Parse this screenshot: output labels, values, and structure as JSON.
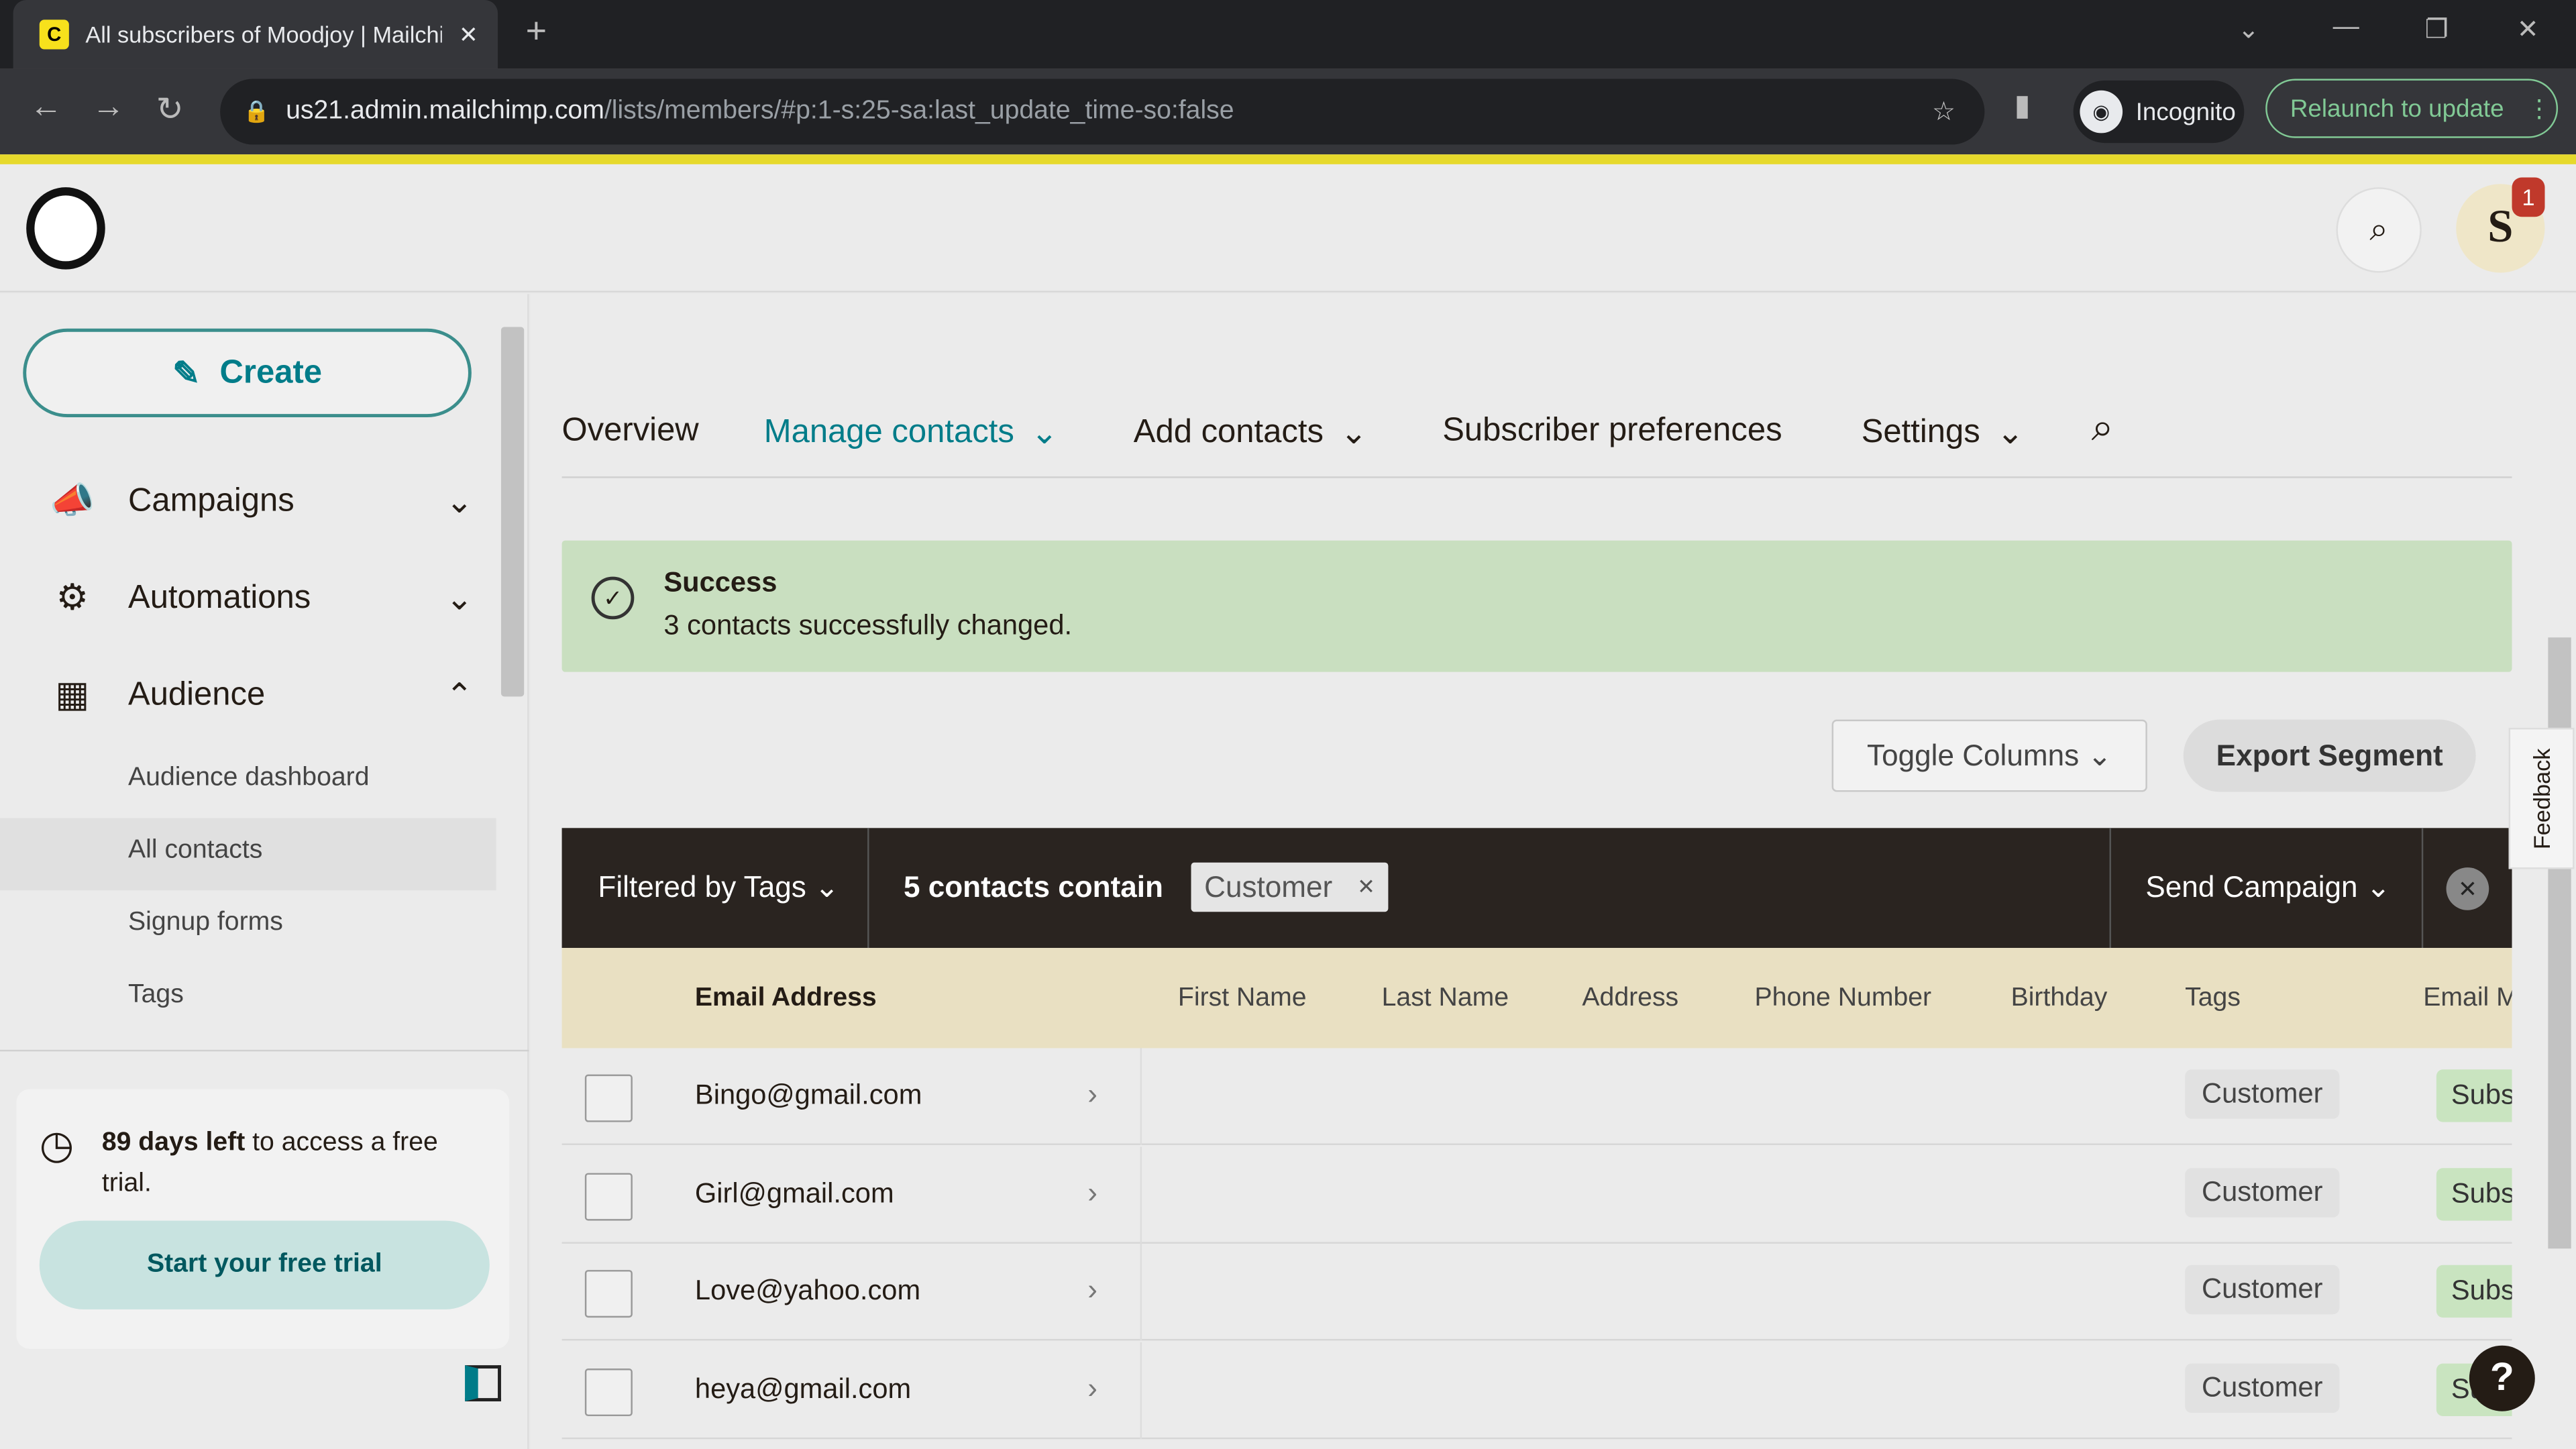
{
  "browser": {
    "tab_title": "All subscribers of Moodjoy | Mailchimp",
    "url_host": "us21.admin.mailchimp.com",
    "url_path": "/lists/members/#p:1-s:25-sa:last_update_time-so:false",
    "incognito": "Incognito",
    "relaunch": "Relaunch to update"
  },
  "header": {
    "avatar_letter": "S",
    "notification_count": "1"
  },
  "sidebar": {
    "create": "Create",
    "items": [
      {
        "label": "Campaigns",
        "icon": "megaphone-icon"
      },
      {
        "label": "Automations",
        "icon": "automation-icon"
      },
      {
        "label": "Audience",
        "icon": "audience-icon"
      }
    ],
    "audience_sub": [
      "Audience dashboard",
      "All contacts",
      "Signup forms",
      "Tags"
    ],
    "trial_days": "89 days left",
    "trial_rest": " to access a free trial.",
    "trial_button": "Start your free trial"
  },
  "tabs": [
    "Overview",
    "Manage contacts",
    "Add contacts",
    "Subscriber preferences",
    "Settings"
  ],
  "success": {
    "title": "Success",
    "message": "3 contacts successfully changed."
  },
  "toolbar": {
    "toggle_columns": "Toggle Columns",
    "export_segment": "Export Segment"
  },
  "filter": {
    "filtered_by": "Filtered by Tags",
    "count_text": "5 contacts contain",
    "tag": "Customer",
    "send_campaign": "Send Campaign"
  },
  "table": {
    "columns": [
      "Email Address",
      "First Name",
      "Last Name",
      "Address",
      "Phone Number",
      "Birthday",
      "Tags",
      "Email Marketing"
    ],
    "rows": [
      {
        "email": "Bingo@gmail.com",
        "tag": "Customer",
        "status": "Subscribed"
      },
      {
        "email": "Girl@gmail.com",
        "tag": "Customer",
        "status": "Subscribed"
      },
      {
        "email": "Love@yahoo.com",
        "tag": "Customer",
        "status": "Subscribed"
      },
      {
        "email": "heya@gmail.com",
        "tag": "Customer",
        "status": "Subscribed"
      }
    ]
  },
  "feedback": "Feedback",
  "help": "?",
  "colors": {
    "accent": "#007c89",
    "success_bg": "#c9dfc0",
    "filter_bar": "#2a2420",
    "table_header": "#e9e0c2",
    "brand_yellow": "#e6d92c"
  }
}
